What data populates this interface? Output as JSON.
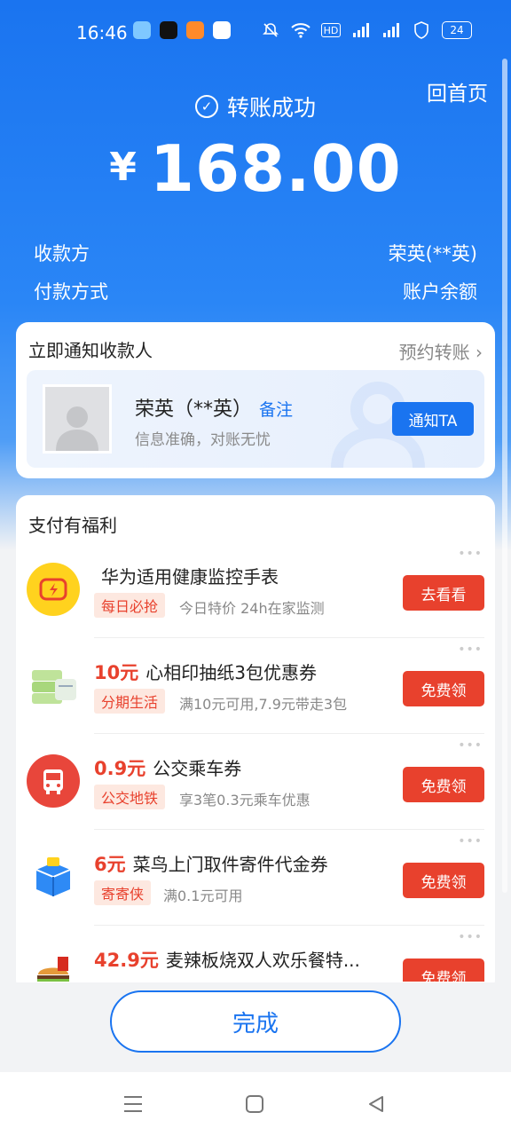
{
  "status_bar": {
    "time": "16:46",
    "battery": "24"
  },
  "header": {
    "home_link": "回首页",
    "success_text": "转账成功",
    "currency": "¥",
    "amount": "168.00"
  },
  "details": {
    "payee_label": "收款方",
    "payee_value": "荣英(**英)",
    "method_label": "付款方式",
    "method_value": "账户余额"
  },
  "notify_card": {
    "title": "立即通知收款人",
    "link": "预约转账",
    "payee_name": "荣英（**英）",
    "note_link": "备注",
    "subtitle": "信息准确，对账无忧",
    "notify_button": "通知TA"
  },
  "benefits": {
    "title": "支付有福利",
    "items": [
      {
        "price": "",
        "title": "华为适用健康监控手表",
        "tag": "每日必抢",
        "desc": "今日特价 24h在家监测",
        "button": "去看看"
      },
      {
        "price": "10元",
        "title": "心相印抽纸3包优惠券",
        "tag": "分期生活",
        "desc": "满10元可用,7.9元带走3包",
        "button": "免费领"
      },
      {
        "price": "0.9元",
        "title": "公交乘车券",
        "tag": "公交地铁",
        "desc": "享3笔0.3元乘车优惠",
        "button": "免费领"
      },
      {
        "price": "6元",
        "title": "菜鸟上门取件寄件代金券",
        "tag": "寄寄侠",
        "desc": "满0.1元可用",
        "button": "免费领"
      },
      {
        "price": "42.9元",
        "title": "麦辣板烧双人欢乐餐特...",
        "tag": "",
        "desc": "",
        "button": "免费领"
      }
    ]
  },
  "footer": {
    "done_button": "完成"
  },
  "colors": {
    "primary": "#1a74f0",
    "accent_red": "#e8412d"
  }
}
